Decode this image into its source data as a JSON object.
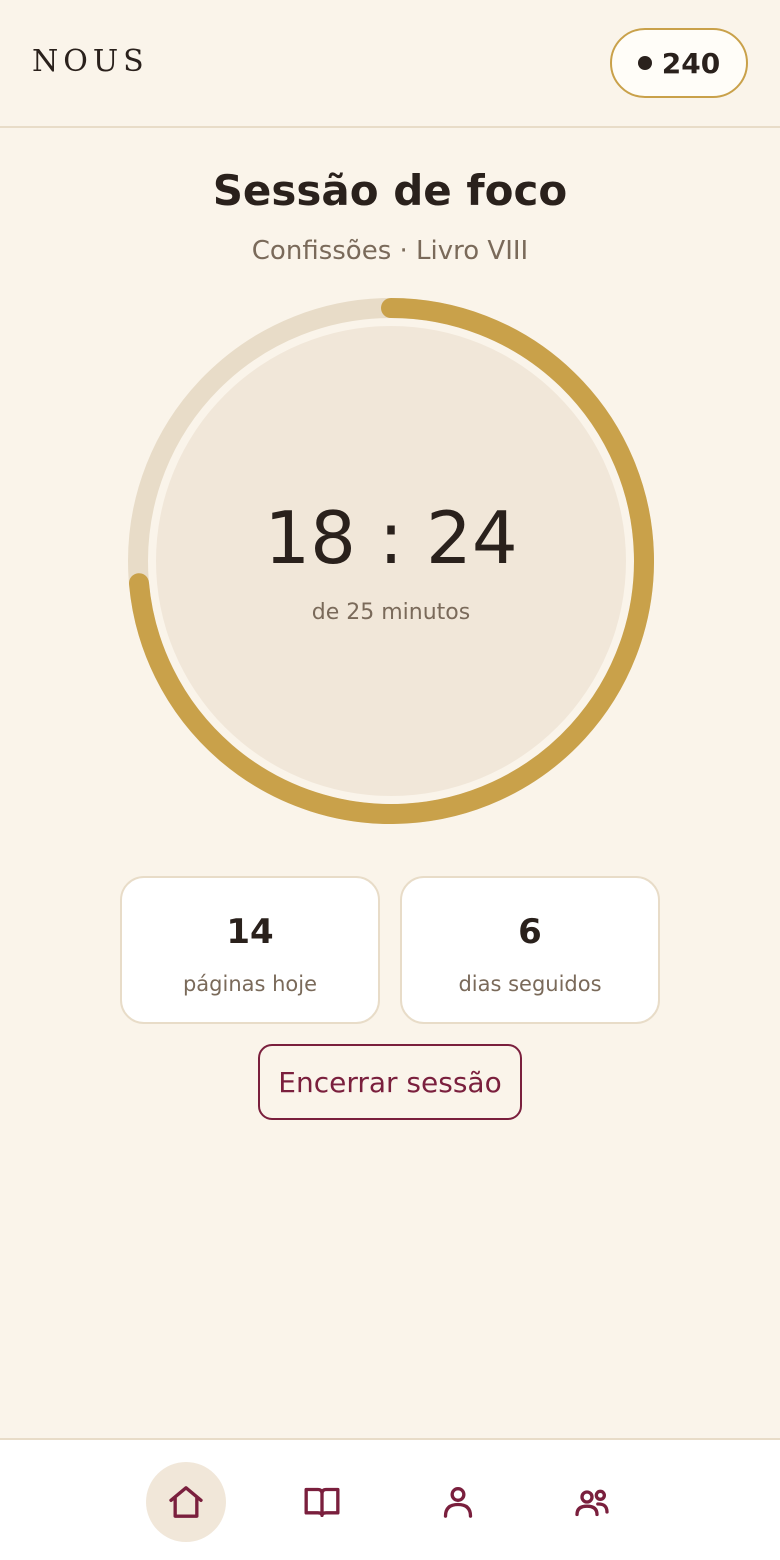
{
  "header": {
    "brand": "NOUS",
    "points": "240"
  },
  "session": {
    "title": "Sessão de foco",
    "subtitle": "Confissões · Livro VIII",
    "timer": "18 : 24",
    "timer_caption": "de 25 minutos",
    "progress_fraction": 0.736
  },
  "stats": [
    {
      "value": "14",
      "label": "páginas hoje"
    },
    {
      "value": "6",
      "label": "dias seguidos"
    }
  ],
  "actions": {
    "end_label": "Encerrar sessão"
  },
  "nav": {
    "items": [
      {
        "icon": "home-icon",
        "active": true
      },
      {
        "icon": "book-icon",
        "active": false
      },
      {
        "icon": "person-icon",
        "active": false
      },
      {
        "icon": "group-icon",
        "active": false
      }
    ]
  },
  "colors": {
    "background": "#faf4ea",
    "accent_gold": "#c9a14a",
    "accent_wine": "#7a1f3d",
    "text": "#2a211c",
    "muted": "#7a6a5a",
    "track": "#e8dcc8",
    "inner_circle": "#f1e7d9"
  }
}
